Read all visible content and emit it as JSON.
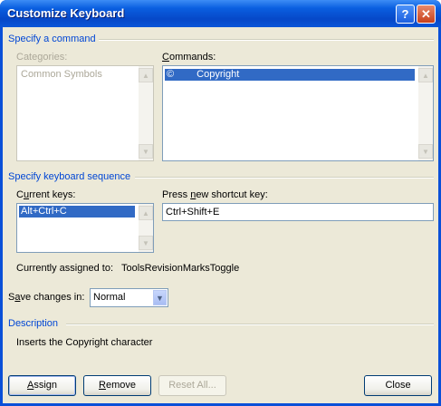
{
  "window": {
    "title": "Customize Keyboard",
    "help_glyph": "?",
    "close_glyph": "✕"
  },
  "specify_command": {
    "group_label": "Specify a command",
    "categories_label": "Categories:",
    "categories_items": [
      "Common Symbols"
    ],
    "commands_label": "Commands:",
    "commands_items": [
      {
        "symbol": "©",
        "name": "Copyright",
        "selected": true
      }
    ]
  },
  "keyboard_sequence": {
    "group_label": "Specify keyboard sequence",
    "current_keys_label": "Current keys:",
    "current_keys_items": [
      "Alt+Ctrl+C"
    ],
    "new_key_label": "Press new shortcut key:",
    "new_key_value": "Ctrl+Shift+E"
  },
  "assigned": {
    "label": "Currently assigned to:",
    "value": "ToolsRevisionMarksToggle"
  },
  "save_changes": {
    "label": "Save changes in:",
    "value": "Normal"
  },
  "description": {
    "group_label": "Description",
    "text": "Inserts the Copyright character"
  },
  "buttons": {
    "assign": "Assign",
    "remove": "Remove",
    "reset_all": "Reset All...",
    "close": "Close"
  },
  "colors": {
    "titlebar": "#0a5fe0",
    "group_label": "#0046d5",
    "selection": "#316ac5",
    "face": "#ece9d8"
  }
}
